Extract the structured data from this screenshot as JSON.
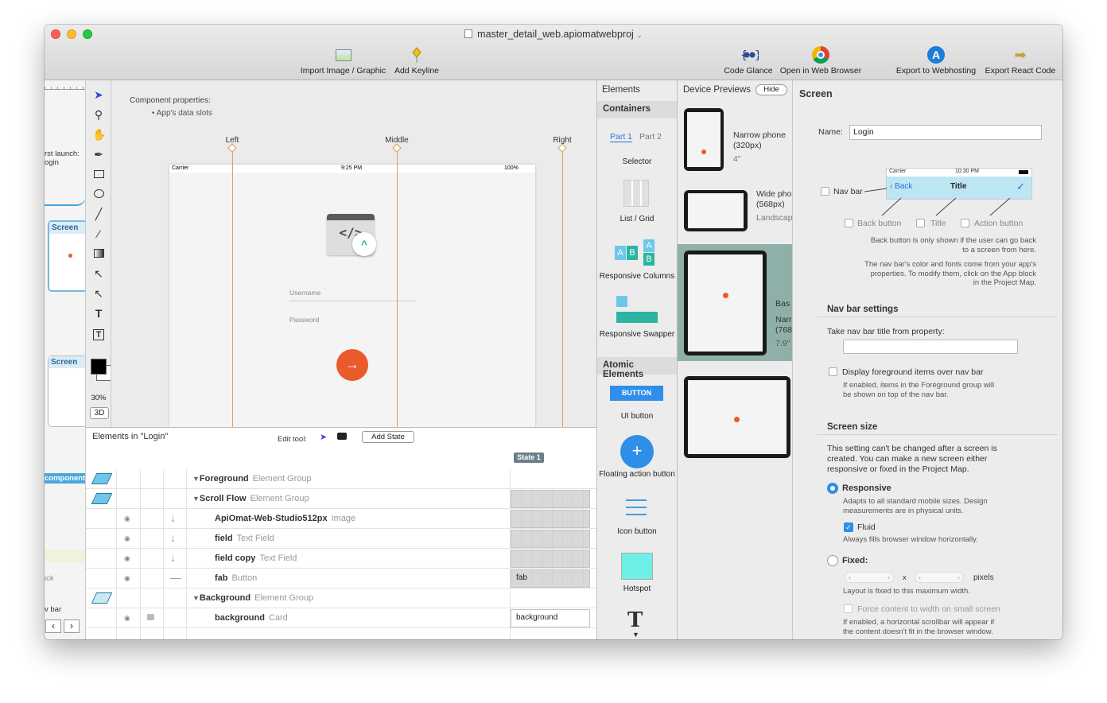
{
  "window": {
    "title": "master_detail_web.apiomatwebproj"
  },
  "toolbar": {
    "import": "Import Image / Graphic",
    "keyline": "Add Keyline",
    "glance": "Code Glance",
    "browser": "Open in Web Browser",
    "webhosting": "Export to Webhosting",
    "react": "Export React Code"
  },
  "minimap": {
    "launch1": "rst launch:",
    "launch2": "ogin",
    "screen1": "Screen",
    "screen2": "Screen",
    "component": "component",
    "tick": "ick",
    "vbar": "v bar"
  },
  "tools": {
    "zoom": "30%",
    "mode3d": "3D"
  },
  "canvas": {
    "props_title": "Component properties:",
    "props_item": "• App's data slots",
    "keylines": [
      "Left",
      "Middle",
      "Right"
    ],
    "status_carrier": "Carrier",
    "status_time": "9:25 PM",
    "status_battery": "100%",
    "username": "Username",
    "password": "Password"
  },
  "elements": {
    "title": "Elements in \"Login\"",
    "edit_tool": "Edit tool:",
    "add_state": "Add State",
    "state": "State 1",
    "rows": [
      {
        "name": "Foreground",
        "type": "Element Group"
      },
      {
        "name": "Scroll Flow",
        "type": "Element Group"
      },
      {
        "name": "ApiOmat-Web-Studio512px",
        "type": "Image"
      },
      {
        "name": "field",
        "type": "Text Field"
      },
      {
        "name": "field copy",
        "type": "Text Field"
      },
      {
        "name": "fab",
        "type": "Button"
      },
      {
        "name": "Background",
        "type": "Element Group"
      },
      {
        "name": "background",
        "type": "Card"
      }
    ],
    "cell_fab": "fab",
    "cell_background": "background"
  },
  "palette": {
    "title": "Elements",
    "containers": "Containers",
    "part1": "Part 1",
    "part2": "Part 2",
    "selector": "Selector",
    "list_grid": "List / Grid",
    "resp_columns": "Responsive Columns",
    "resp_swapper": "Responsive Swapper",
    "atomic": "Atomic Elements",
    "button_label": "BUTTON",
    "ui_button": "UI button",
    "fab": "Floating action button",
    "icon_button": "Icon button",
    "hotspot": "Hotspot",
    "text_icon": "T"
  },
  "previews": {
    "title": "Device Previews",
    "hide": "Hide",
    "narrow_name": "Narrow phone",
    "narrow_px": "(320px)",
    "narrow_in": "4\"",
    "wide_name": "Wide pho",
    "wide_px": "(568px)",
    "wide_sub": "Landscap",
    "tab_a": "Bas",
    "tab_b": "Narr",
    "tab_c": "(768",
    "tab_d": "7.9\""
  },
  "props": {
    "title": "Screen",
    "name_label": "Name:",
    "name_value": "Login",
    "navbar": "Nav bar",
    "nb_carrier": "Carrier",
    "nb_time": "10:30 PM",
    "nb_back": "Back",
    "nb_title": "Title",
    "back_button": "Back button",
    "title_opt": "Title",
    "action_button": "Action button",
    "note1": "Back button is only shown if the user can go back to a screen from here.",
    "note2": "The nav bar's color and fonts come from your app's properties. To modify them, click on the App block in the Project Map.",
    "nbs_heading": "Nav bar settings",
    "take_title": "Take nav bar title from property:",
    "display_fg": "Display foreground items over nav bar",
    "display_note": "If enabled, items in the Foreground group will be shown on top of the nav bar.",
    "size_heading": "Screen size",
    "size_note": "This setting can't be changed after a screen is created. You can make a new screen either responsive or fixed in the Project Map.",
    "responsive": "Responsive",
    "responsive_note": "Adapts to all standard mobile sizes. Design measurements are in physical units.",
    "fluid": "Fluid",
    "fluid_note": "Always fills browser window horizontally.",
    "fixed": "Fixed:",
    "x": "x",
    "pixels": "pixels",
    "fixed_note": "Layout is fixed to this maximum width.",
    "force": "Force content to width on small screen",
    "force_note": "If enabled, a horizontal scrollbar will appear if the content doesn't fit in the browser window."
  },
  "colors": {
    "accent": "#2e6fd8",
    "fab": "#ea5a2a",
    "teal": "#2bb5a0",
    "keyline": "#e0a060"
  }
}
